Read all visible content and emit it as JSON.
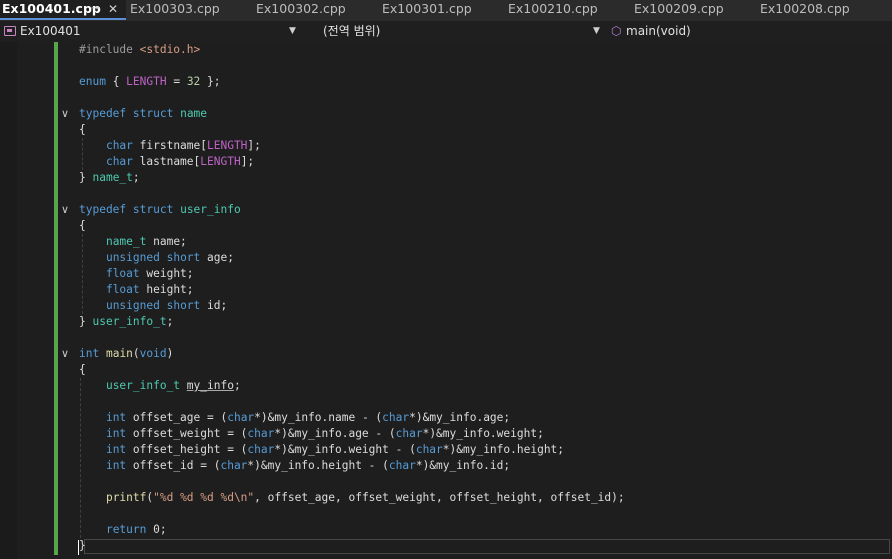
{
  "tabs": [
    {
      "label": "Ex100401.cpp",
      "active": true
    },
    {
      "label": "Ex100303.cpp"
    },
    {
      "label": "Ex100302.cpp"
    },
    {
      "label": "Ex100301.cpp"
    },
    {
      "label": "Ex100210.cpp"
    },
    {
      "label": "Ex100209.cpp"
    },
    {
      "label": "Ex100208.cpp"
    }
  ],
  "active_tab_icons": {
    "pin": "pin-icon",
    "close": "close-icon"
  },
  "navbar": {
    "project": "Ex100401",
    "scope": "(전역 범위)",
    "member": "main(void)",
    "icons": {
      "project": "cpp-project-icon",
      "member": "method-cube-icon",
      "dropdown": "chevron-down-icon"
    }
  },
  "colors": {
    "keyword": "#569cd6",
    "type": "#4ec9b0",
    "function": "#dcdcaa",
    "string": "#d69d85",
    "macro": "#bd63c5",
    "change_bar": "#57a64a",
    "background": "#1e1e1e"
  },
  "code": {
    "line1": {
      "a": "#include ",
      "b": "<stdio.h>"
    },
    "line3": {
      "a": "enum",
      "b": " { ",
      "c": "LENGTH",
      "d": " = ",
      "e": "32",
      "f": " };"
    },
    "line5": {
      "a": "typedef",
      "b": "struct",
      "c": "name"
    },
    "line6": "{",
    "line7": {
      "a": "char",
      "b": " firstname[",
      "c": "LENGTH",
      "d": "];"
    },
    "line8": {
      "a": "char",
      "b": " lastname[",
      "c": "LENGTH",
      "d": "];"
    },
    "line9": {
      "a": "} ",
      "b": "name_t",
      "c": ";"
    },
    "line11": {
      "a": "typedef",
      "b": "struct",
      "c": "user_info"
    },
    "line12": "{",
    "line13": {
      "a": "name_t",
      "b": " name;"
    },
    "line14": {
      "a": "unsigned",
      "b": "short",
      "c": " age;"
    },
    "line15": {
      "a": "float",
      "b": " weight;"
    },
    "line16": {
      "a": "float",
      "b": " height;"
    },
    "line17": {
      "a": "unsigned",
      "b": "short",
      "c": " id;"
    },
    "line18": {
      "a": "} ",
      "b": "user_info_t",
      "c": ";"
    },
    "line20": {
      "a": "int",
      "b": "main",
      "c": "(",
      "d": "void",
      "e": ")"
    },
    "line21": "{",
    "line22": {
      "a": "user_info_t",
      "b": "my_info",
      "c": ";"
    },
    "line24": {
      "a": "int",
      "b": " offset_age = (",
      "c": "char",
      "d": "*)&my_info.name - (",
      "e": "char",
      "f": "*)&my_info.age;"
    },
    "line25": {
      "a": "int",
      "b": " offset_weight = (",
      "c": "char",
      "d": "*)&my_info.age - (",
      "e": "char",
      "f": "*)&my_info.weight;"
    },
    "line26": {
      "a": "int",
      "b": " offset_height = (",
      "c": "char",
      "d": "*)&my_info.weight - (",
      "e": "char",
      "f": "*)&my_info.height;"
    },
    "line27": {
      "a": "int",
      "b": " offset_id = (",
      "c": "char",
      "d": "*)&my_info.height - (",
      "e": "char",
      "f": "*)&my_info.id;"
    },
    "line29": {
      "a": "printf",
      "b": "(",
      "c": "\"%d %d %d %d\\n\"",
      "d": ", offset_age, offset_weight, offset_height, offset_id);"
    },
    "line31": {
      "a": "return",
      "b": " 0;"
    },
    "line32": "}"
  }
}
